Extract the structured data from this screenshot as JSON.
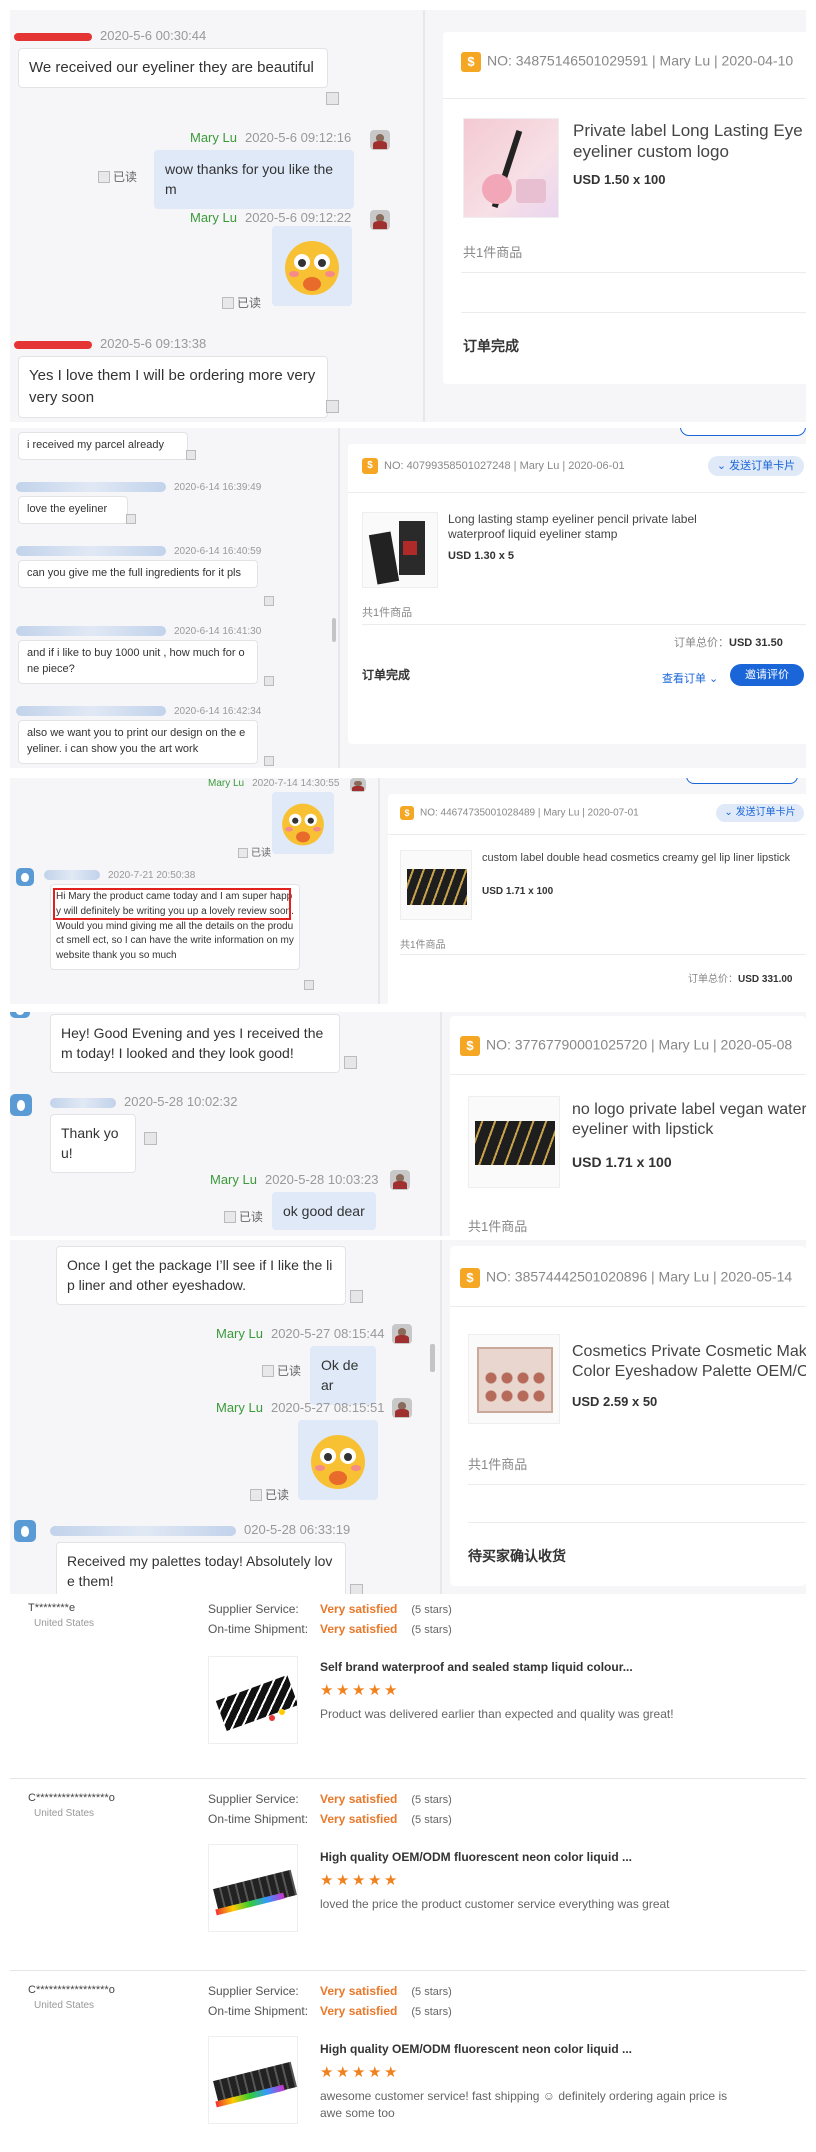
{
  "s1": {
    "m1_time": "2020-5-6 00:30:44",
    "m1_text": "We received our eyeliner they are beautiful",
    "m2_name": "Mary Lu",
    "m2_time": "2020-5-6 09:12:16",
    "m2_text": "wow thanks for you like them",
    "read": "已读",
    "m3_name": "Mary Lu",
    "m3_time": "2020-5-6 09:12:22",
    "m4_time": "2020-5-6 09:13:38",
    "m4_text": "Yes I love them I will be ordering more very very soon",
    "order_no": "NO: 34875146501029591 | Mary Lu | 2020-04-10",
    "product": "Private label Long Lasting Eye liner pencil, eyeliner custom logo",
    "price": "USD 1.50 x 100",
    "count": "共1件商品",
    "status": "订单完成"
  },
  "s2": {
    "m0_text": "i received my parcel already",
    "m1_time": "2020-6-14 16:39:49",
    "m1_text": "love the eyeliner",
    "m2_time": "2020-6-14 16:40:59",
    "m2_text": "can you give me the full ingredients for it pls",
    "m3_time": "2020-6-14 16:41:30",
    "m3_text": "and if i like to buy 1000 unit , how much for one piece?",
    "m4_time": "2020-6-14 16:42:34",
    "m4_text": "also we want you to print our design on the eyeliner. i can show you the art work",
    "order_no": "NO: 40799358501027248 | Mary Lu | 2020-06-01",
    "send_card": "发送订单卡片",
    "product": "Long lasting stamp eyeliner pencil private label waterproof liquid eyeliner stamp",
    "price": "USD 1.30 x 5",
    "count": "共1件商品",
    "total_label": "订单总价：",
    "total": "USD 31.50",
    "status": "订单完成",
    "view_order": "查看订单",
    "invite_review": "邀请评价"
  },
  "s3": {
    "m1_name": "Mary Lu",
    "m1_time": "2020-7-14 14:30:55",
    "read": "已读",
    "m2_time": "2020-7-21 20:50:38",
    "m2_text": "Hi Mary the product came today and I am super happy will definitely be writing you up a lovely review soon.Would you mind giving me all the details on the product smell ect, so I can have the write information on my website thank you so much",
    "order_no": "NO: 44674735001028489 | Mary Lu | 2020-07-01",
    "send_card": "发送订单卡片",
    "product": "custom label double head cosmetics creamy gel lip liner lipstick",
    "price": "USD 1.71 x 100",
    "count": "共1件商品",
    "total_label": "订单总价：",
    "total": "USD 331.00"
  },
  "s4": {
    "m1_text": "Hey! Good Evening and yes I received them today! I looked and they look good!",
    "m2_time": "2020-5-28 10:02:32",
    "m2_text": "Thank you!",
    "m3_name": "Mary Lu",
    "m3_time": "2020-5-28 10:03:23",
    "read": "已读",
    "m3_text": "ok good dear",
    "order_no": "NO: 37767790001025720 | Mary Lu | 2020-05-08",
    "product": "no logo private label vegan waterproof eyeliner with lipstick",
    "price": "USD 1.71 x 100",
    "count": "共1件商品"
  },
  "s5": {
    "m1_text": "Once I get the package I’ll see if I like the lip liner and other eyeshadow.",
    "m2_name": "Mary Lu",
    "m2_time": "2020-5-27 08:15:44",
    "read": "已读",
    "m2_text": "Ok dear",
    "m3_name": "Mary Lu",
    "m3_time": "2020-5-27 08:15:51",
    "m4_time": "020-5-28 06:33:19",
    "m4_text": "Received my palettes today! Absolutely love them!",
    "order_no": "NO: 38574442501020896 | Mary Lu | 2020-05-14",
    "product": "Cosmetics Private Cosmetic Makeup Color Eyeshadow Palette OEM/ODM",
    "price": "USD 2.59 x 50",
    "count": "共1件商品",
    "status": "待买家确认收货"
  },
  "reviews": {
    "supplier_label": "Supplier Service:",
    "ontime_label": "On-time Shipment:",
    "very_satisfied": "Very satisfied",
    "five_stars": "(5 stars)",
    "r1_user": "T********e",
    "r1_country": "United States",
    "r1_product": "Self brand waterproof and sealed stamp liquid colour...",
    "r1_text": "Product was delivered earlier than expected and quality was great!",
    "r2_user": "C*****************o",
    "r2_country": "United States",
    "r2_product": "High quality OEM/ODM fluorescent neon color liquid ...",
    "r2_text": "loved the price the product customer service everything was great",
    "r3_user": "C*****************o",
    "r3_country": "United States",
    "r3_product": "High quality OEM/ODM fluorescent neon color liquid ...",
    "r3_text": "awesome customer service! fast shipping ☺ definitely ordering again price is awe some too"
  },
  "icons": {
    "order": "order-badge-icon",
    "avatar": "seller-avatar-icon",
    "emoji": "blushing-emoji",
    "star": "star-icon"
  },
  "colors": {
    "accent": "#1a66d8",
    "name_green": "#3a9a3a",
    "badge": "#f5a623",
    "rating": "#e8782a"
  }
}
